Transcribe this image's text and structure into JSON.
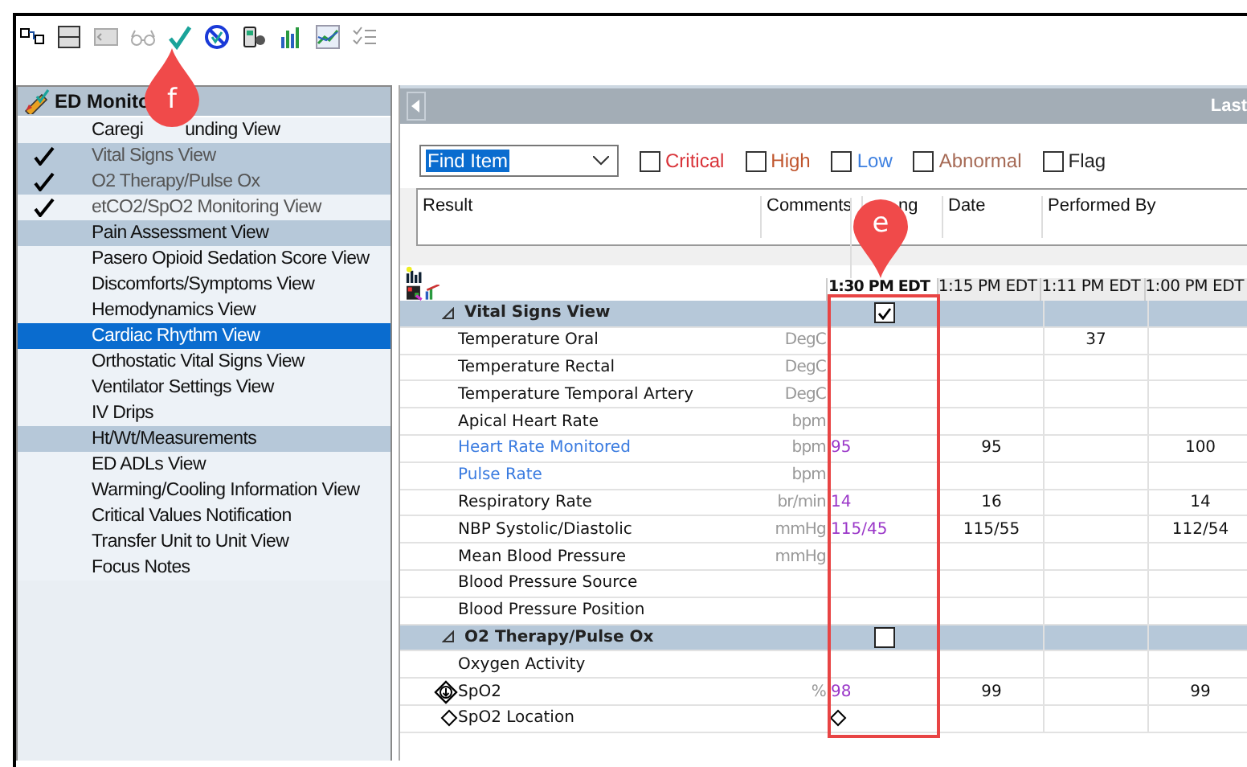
{
  "callouts": [
    {
      "label": "f"
    },
    {
      "label": "e"
    }
  ],
  "views_panel": {
    "title": "ED Monito",
    "items": [
      {
        "label": "Caregi",
        "label_after": "unding View",
        "checked": false,
        "shaded": false,
        "selected": false
      },
      {
        "label": "Vital Signs View",
        "checked": true,
        "shaded": true,
        "selected": false
      },
      {
        "label": "O2 Therapy/Pulse Ox",
        "checked": true,
        "shaded": true,
        "selected": false
      },
      {
        "label": "etCO2/SpO2 Monitoring View",
        "checked": true,
        "shaded": false,
        "selected": false
      },
      {
        "label": "Pain Assessment View",
        "checked": false,
        "shaded": true,
        "selected": false
      },
      {
        "label": "Pasero Opioid Sedation Score View",
        "checked": false,
        "shaded": false,
        "selected": false
      },
      {
        "label": "Discomforts/Symptoms View",
        "checked": false,
        "shaded": false,
        "selected": false
      },
      {
        "label": "Hemodynamics View",
        "checked": false,
        "shaded": false,
        "selected": false
      },
      {
        "label": "Cardiac Rhythm View",
        "checked": false,
        "shaded": false,
        "selected": true
      },
      {
        "label": "Orthostatic Vital Signs View",
        "checked": false,
        "shaded": false,
        "selected": false
      },
      {
        "label": "Ventilator Settings View",
        "checked": false,
        "shaded": false,
        "selected": false
      },
      {
        "label": "IV Drips",
        "checked": false,
        "shaded": false,
        "selected": false
      },
      {
        "label": "Ht/Wt/Measurements",
        "checked": false,
        "shaded": true,
        "selected": false
      },
      {
        "label": "ED ADLs View",
        "checked": false,
        "shaded": false,
        "selected": false
      },
      {
        "label": "Warming/Cooling Information View",
        "checked": false,
        "shaded": false,
        "selected": false
      },
      {
        "label": "Critical Values Notification",
        "checked": false,
        "shaded": false,
        "selected": false
      },
      {
        "label": "Transfer Unit to Unit View",
        "checked": false,
        "shaded": false,
        "selected": false
      },
      {
        "label": "Focus Notes",
        "checked": false,
        "shaded": false,
        "selected": false
      }
    ]
  },
  "results_panel": {
    "nav_label": "Last",
    "find": {
      "value": "Find Item"
    },
    "filters": [
      {
        "label": "Critical",
        "checked": false,
        "color": "#d9343a"
      },
      {
        "label": "High",
        "checked": false,
        "color": "#c0562e"
      },
      {
        "label": "Low",
        "checked": false,
        "color": "#3c7fe0"
      },
      {
        "label": "Abnormal",
        "checked": false,
        "color": "#a66a55"
      },
      {
        "label": "Flag",
        "checked": false,
        "color": "#222222"
      }
    ],
    "columns": [
      "Result",
      "Comments",
      "ng",
      "Date",
      "Performed By"
    ]
  },
  "flowsheet": {
    "times": [
      {
        "label": "1:30 PM EDT",
        "selected": true,
        "unsigned": true
      },
      {
        "label": "1:15 PM EDT",
        "selected": false,
        "unsigned": false
      },
      {
        "label": "1:11 PM EDT",
        "selected": false,
        "unsigned": false
      },
      {
        "label": "1:00 PM EDT",
        "selected": false,
        "unsigned": false
      }
    ],
    "rows": [
      {
        "kind": "section",
        "label": "Vital Signs View",
        "expanded": true,
        "checked": true
      },
      {
        "kind": "item",
        "label": "Temperature Oral",
        "unit": "DegC",
        "linked": false,
        "values": {
          "time_3": "37"
        }
      },
      {
        "kind": "item",
        "label": "Temperature Rectal",
        "unit": "DegC",
        "linked": false
      },
      {
        "kind": "item",
        "label": "Temperature Temporal Artery",
        "unit": "DegC",
        "linked": false
      },
      {
        "kind": "item",
        "label": "Apical Heart Rate",
        "unit": "bpm",
        "linked": false
      },
      {
        "kind": "item",
        "label": "Heart Rate Monitored",
        "unit": "bpm",
        "linked": true,
        "values": {
          "time_1": "95",
          "time_2": "95",
          "time_4": "100"
        }
      },
      {
        "kind": "item",
        "label": "Pulse Rate",
        "unit": "bpm",
        "linked": true
      },
      {
        "kind": "item",
        "label": "Respiratory Rate",
        "unit": "br/min",
        "linked": false,
        "values": {
          "time_1": "14",
          "time_2": "16",
          "time_4": "14"
        }
      },
      {
        "kind": "item",
        "label": "NBP Systolic/Diastolic",
        "unit": "mmHg",
        "linked": false,
        "values": {
          "time_1": "115/45",
          "time_2": "115/55",
          "time_4": "112/54"
        }
      },
      {
        "kind": "item",
        "label": "Mean Blood Pressure",
        "unit": "mmHg",
        "linked": false
      },
      {
        "kind": "item",
        "label": "Blood Pressure Source",
        "linked": false
      },
      {
        "kind": "item",
        "label": "Blood Pressure Position",
        "linked": false
      },
      {
        "kind": "section",
        "label": "O2 Therapy/Pulse Ox",
        "expanded": true,
        "checked": false
      },
      {
        "kind": "item",
        "label": "Oxygen Activity",
        "linked": false
      },
      {
        "kind": "alert",
        "label": "SpO2",
        "unit": "%",
        "linked": false,
        "values": {
          "time_1": "98",
          "time_2": "99",
          "time_4": "99"
        }
      },
      {
        "kind": "marked",
        "label": "SpO2 Location",
        "linked": false
      }
    ]
  }
}
